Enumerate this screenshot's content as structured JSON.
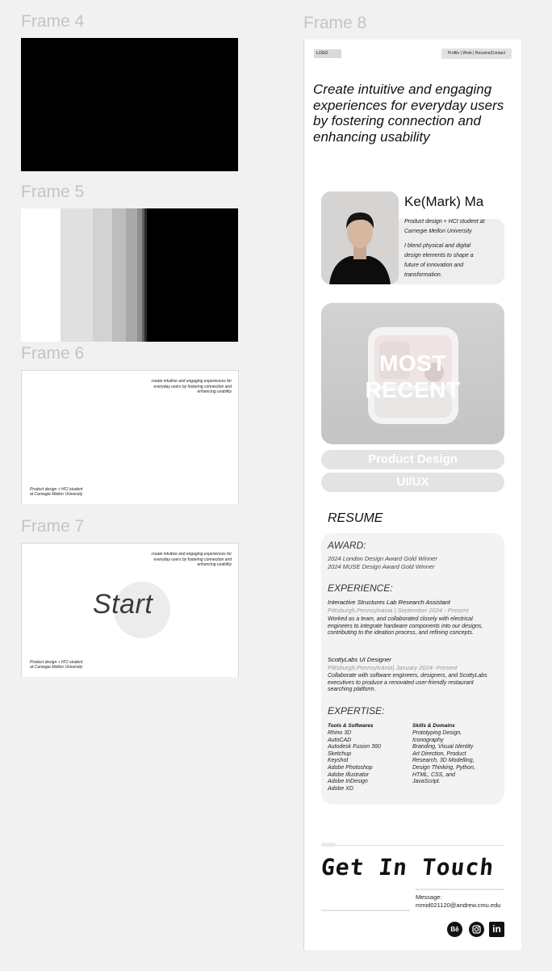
{
  "frames": {
    "f4": {
      "label": "Frame 4"
    },
    "f5": {
      "label": "Frame 5",
      "stripes": [
        "#ffffff",
        "#e0e0e0",
        "#d2d2d2",
        "#bdbdbd",
        "#a9a9a9",
        "#8e8e8e",
        "#5f5f5f",
        "#2a2a2a",
        "#000000"
      ]
    },
    "f6": {
      "label": "Frame 6",
      "tagline": "create intuitive and engaging experiences for everyday users by fostering connection and enhancing usability",
      "footer_line1": "Product design + HCI student",
      "footer_line2": "at Carnegie Mellon University"
    },
    "f7": {
      "label": "Frame 7",
      "tagline": "create intuitive and engaging experiences for everyday users by fostering connection and enhancing usability",
      "start": "Start",
      "footer_line1": "Product design + HCI student",
      "footer_line2": "at Carnegie Mellon University"
    },
    "f8": {
      "label": "Frame 8"
    }
  },
  "portfolio": {
    "logo": "LOGO",
    "nav": "Profile | Work | Resume|Contact",
    "hero": "Create intuitive and engaging experiences for everyday users by fostering connection and enhancing usability",
    "name": "Ke(Mark) Ma",
    "bio1": "Product design + HCI student at Carnegie Mellon University",
    "bio2": "I blend physical and digital design elements to shape a future of innovation and transformation.",
    "most_recent": "MOST\nRECENT",
    "pill_product": "Product Design",
    "pill_ux": "UI/UX",
    "resume_title": "RESUME",
    "award_head": "AWARD:",
    "award1": "2024 London Design Award Gold Winner",
    "award2": "2024 MUSE Design Award Gold Winner",
    "exp_head": "EXPERIENCE:",
    "exp1_title": "Interactive Structures Lab Research Assistant",
    "exp1_meta": "Pittsburgh,Pennsylvania | September 2024 - Present",
    "exp1_body": "Worked as a team, and collaborated closely with electrical engineers to integrate hardware components into our designs, contributing to the ideation process, and refining concepts.",
    "exp2_title": "ScottyLabs UI Designer",
    "exp2_meta": "Pittsburgh,Pennsylvania| January 2024- Present",
    "exp2_body": "Collaborate with software engineers, designers, and ScottyLabs executives to produce a renovated user-friendly restaurant searching platform.",
    "expertise_head": "EXPERTISE:",
    "tools_head": "Tools & Softwares",
    "tools": [
      "Rhino 3D",
      "AutoCAD",
      "Autodesk Fusion 360",
      "Sketchup",
      "Keyshot",
      "Adobe Photoshop",
      "Adobe Illustrator",
      "Adobe InDesign",
      "Adobe XD"
    ],
    "skills_head": "Skills & Domains",
    "skills": [
      "Prototyping Design,",
      "Iconography",
      "Branding, Visual Identity",
      "Art Direction, Product",
      "Research, 3D Modelling,",
      "Design Thinking, Python,",
      "HTML, CSS, and",
      "JavaScript."
    ],
    "get_in_touch": "Get In Touch",
    "message_label": "Message:",
    "email": "mmid021120@andrew.cmu.edu",
    "behance": "Bē",
    "linkedin": "in"
  },
  "icons": {
    "behance": "behance-icon",
    "instagram": "instagram-icon",
    "linkedin": "linkedin-icon"
  }
}
